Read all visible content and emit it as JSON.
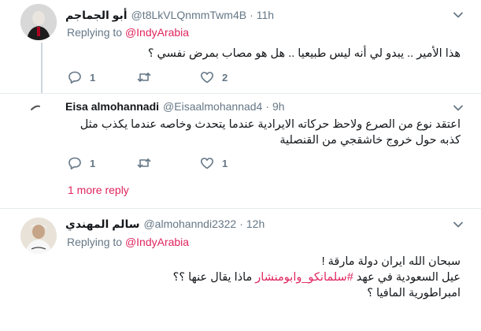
{
  "tweets": [
    {
      "name": "أبو الجماجم",
      "handle": "@t8LkVLQnmmTwm4B",
      "dot": "·",
      "time": "11h",
      "replying_prefix": "Replying to ",
      "replying_to": "@IndyArabia",
      "text": "هذا الأمير .. يبدو لي أنه ليس طبيعيا .. هل هو مصاب بمرض نفسي ؟",
      "reply_count": "1",
      "retweet_count": "",
      "like_count": "2"
    },
    {
      "name": "Eisa almohannadi",
      "handle": "@Eisaalmohannad4",
      "dot": "·",
      "time": "9h",
      "text": "اعتقد نوع من الصرع ولاحظ حركاته الايرادية عندما يتحدث وخاصه عندما يكذب مثل كذبه حول خروج خاشقجي من القنصلية",
      "reply_count": "1",
      "retweet_count": "",
      "like_count": "1",
      "more_replies": "1 more reply"
    },
    {
      "name": "سالم المهندي",
      "handle": "@almohanndi2322",
      "dot": "·",
      "time": "12h",
      "replying_prefix": "Replying to ",
      "replying_to": "@IndyArabia",
      "line1": "سبحان الله ايران دولة مارقة !",
      "line2_pre": "عيل السعودية في عهد ",
      "line2_hashtag": "#سلمانكو_وابومنشار",
      "line2_post": " ماذا يقال عنها ؟؟",
      "line3": "امبراطورية المافيا ؟"
    }
  ],
  "icons": {
    "chevron": "chevron-down-icon",
    "reply": "reply-icon",
    "retweet": "retweet-icon",
    "like": "heart-icon"
  },
  "colors": {
    "accent": "#e0245e",
    "secondary_text": "#657786",
    "divider": "#e6ecf0"
  }
}
